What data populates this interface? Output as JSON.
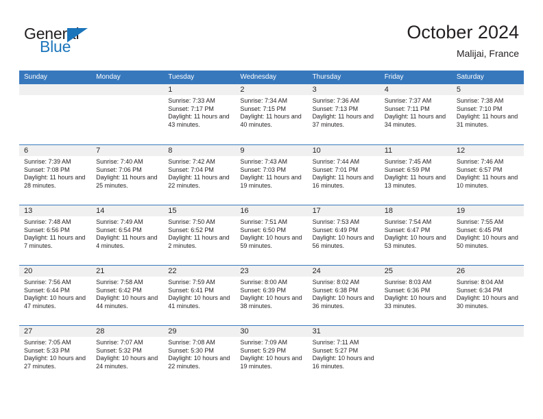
{
  "brand": {
    "name_top": "General",
    "name_bottom": "Blue",
    "accent_color": "#1b75bb",
    "triangle_icon": "brand-triangle-icon"
  },
  "header": {
    "title": "October 2024",
    "subtitle": "Malijai, France"
  },
  "calendar": {
    "header_bg": "#3778bd",
    "day_band_bg": "#f0f0f0",
    "weekdays": [
      "Sunday",
      "Monday",
      "Tuesday",
      "Wednesday",
      "Thursday",
      "Friday",
      "Saturday"
    ],
    "weeks": [
      [
        {
          "empty": true
        },
        {
          "empty": true
        },
        {
          "date": "1",
          "sunrise": "Sunrise: 7:33 AM",
          "sunset": "Sunset: 7:17 PM",
          "daylight": "Daylight: 11 hours and 43 minutes."
        },
        {
          "date": "2",
          "sunrise": "Sunrise: 7:34 AM",
          "sunset": "Sunset: 7:15 PM",
          "daylight": "Daylight: 11 hours and 40 minutes."
        },
        {
          "date": "3",
          "sunrise": "Sunrise: 7:36 AM",
          "sunset": "Sunset: 7:13 PM",
          "daylight": "Daylight: 11 hours and 37 minutes."
        },
        {
          "date": "4",
          "sunrise": "Sunrise: 7:37 AM",
          "sunset": "Sunset: 7:11 PM",
          "daylight": "Daylight: 11 hours and 34 minutes."
        },
        {
          "date": "5",
          "sunrise": "Sunrise: 7:38 AM",
          "sunset": "Sunset: 7:10 PM",
          "daylight": "Daylight: 11 hours and 31 minutes."
        }
      ],
      [
        {
          "date": "6",
          "sunrise": "Sunrise: 7:39 AM",
          "sunset": "Sunset: 7:08 PM",
          "daylight": "Daylight: 11 hours and 28 minutes."
        },
        {
          "date": "7",
          "sunrise": "Sunrise: 7:40 AM",
          "sunset": "Sunset: 7:06 PM",
          "daylight": "Daylight: 11 hours and 25 minutes."
        },
        {
          "date": "8",
          "sunrise": "Sunrise: 7:42 AM",
          "sunset": "Sunset: 7:04 PM",
          "daylight": "Daylight: 11 hours and 22 minutes."
        },
        {
          "date": "9",
          "sunrise": "Sunrise: 7:43 AM",
          "sunset": "Sunset: 7:03 PM",
          "daylight": "Daylight: 11 hours and 19 minutes."
        },
        {
          "date": "10",
          "sunrise": "Sunrise: 7:44 AM",
          "sunset": "Sunset: 7:01 PM",
          "daylight": "Daylight: 11 hours and 16 minutes."
        },
        {
          "date": "11",
          "sunrise": "Sunrise: 7:45 AM",
          "sunset": "Sunset: 6:59 PM",
          "daylight": "Daylight: 11 hours and 13 minutes."
        },
        {
          "date": "12",
          "sunrise": "Sunrise: 7:46 AM",
          "sunset": "Sunset: 6:57 PM",
          "daylight": "Daylight: 11 hours and 10 minutes."
        }
      ],
      [
        {
          "date": "13",
          "sunrise": "Sunrise: 7:48 AM",
          "sunset": "Sunset: 6:56 PM",
          "daylight": "Daylight: 11 hours and 7 minutes."
        },
        {
          "date": "14",
          "sunrise": "Sunrise: 7:49 AM",
          "sunset": "Sunset: 6:54 PM",
          "daylight": "Daylight: 11 hours and 4 minutes."
        },
        {
          "date": "15",
          "sunrise": "Sunrise: 7:50 AM",
          "sunset": "Sunset: 6:52 PM",
          "daylight": "Daylight: 11 hours and 2 minutes."
        },
        {
          "date": "16",
          "sunrise": "Sunrise: 7:51 AM",
          "sunset": "Sunset: 6:50 PM",
          "daylight": "Daylight: 10 hours and 59 minutes."
        },
        {
          "date": "17",
          "sunrise": "Sunrise: 7:53 AM",
          "sunset": "Sunset: 6:49 PM",
          "daylight": "Daylight: 10 hours and 56 minutes."
        },
        {
          "date": "18",
          "sunrise": "Sunrise: 7:54 AM",
          "sunset": "Sunset: 6:47 PM",
          "daylight": "Daylight: 10 hours and 53 minutes."
        },
        {
          "date": "19",
          "sunrise": "Sunrise: 7:55 AM",
          "sunset": "Sunset: 6:45 PM",
          "daylight": "Daylight: 10 hours and 50 minutes."
        }
      ],
      [
        {
          "date": "20",
          "sunrise": "Sunrise: 7:56 AM",
          "sunset": "Sunset: 6:44 PM",
          "daylight": "Daylight: 10 hours and 47 minutes."
        },
        {
          "date": "21",
          "sunrise": "Sunrise: 7:58 AM",
          "sunset": "Sunset: 6:42 PM",
          "daylight": "Daylight: 10 hours and 44 minutes."
        },
        {
          "date": "22",
          "sunrise": "Sunrise: 7:59 AM",
          "sunset": "Sunset: 6:41 PM",
          "daylight": "Daylight: 10 hours and 41 minutes."
        },
        {
          "date": "23",
          "sunrise": "Sunrise: 8:00 AM",
          "sunset": "Sunset: 6:39 PM",
          "daylight": "Daylight: 10 hours and 38 minutes."
        },
        {
          "date": "24",
          "sunrise": "Sunrise: 8:02 AM",
          "sunset": "Sunset: 6:38 PM",
          "daylight": "Daylight: 10 hours and 36 minutes."
        },
        {
          "date": "25",
          "sunrise": "Sunrise: 8:03 AM",
          "sunset": "Sunset: 6:36 PM",
          "daylight": "Daylight: 10 hours and 33 minutes."
        },
        {
          "date": "26",
          "sunrise": "Sunrise: 8:04 AM",
          "sunset": "Sunset: 6:34 PM",
          "daylight": "Daylight: 10 hours and 30 minutes."
        }
      ],
      [
        {
          "date": "27",
          "sunrise": "Sunrise: 7:05 AM",
          "sunset": "Sunset: 5:33 PM",
          "daylight": "Daylight: 10 hours and 27 minutes."
        },
        {
          "date": "28",
          "sunrise": "Sunrise: 7:07 AM",
          "sunset": "Sunset: 5:32 PM",
          "daylight": "Daylight: 10 hours and 24 minutes."
        },
        {
          "date": "29",
          "sunrise": "Sunrise: 7:08 AM",
          "sunset": "Sunset: 5:30 PM",
          "daylight": "Daylight: 10 hours and 22 minutes."
        },
        {
          "date": "30",
          "sunrise": "Sunrise: 7:09 AM",
          "sunset": "Sunset: 5:29 PM",
          "daylight": "Daylight: 10 hours and 19 minutes."
        },
        {
          "date": "31",
          "sunrise": "Sunrise: 7:11 AM",
          "sunset": "Sunset: 5:27 PM",
          "daylight": "Daylight: 10 hours and 16 minutes."
        },
        {
          "empty": true
        },
        {
          "empty": true
        }
      ]
    ]
  }
}
